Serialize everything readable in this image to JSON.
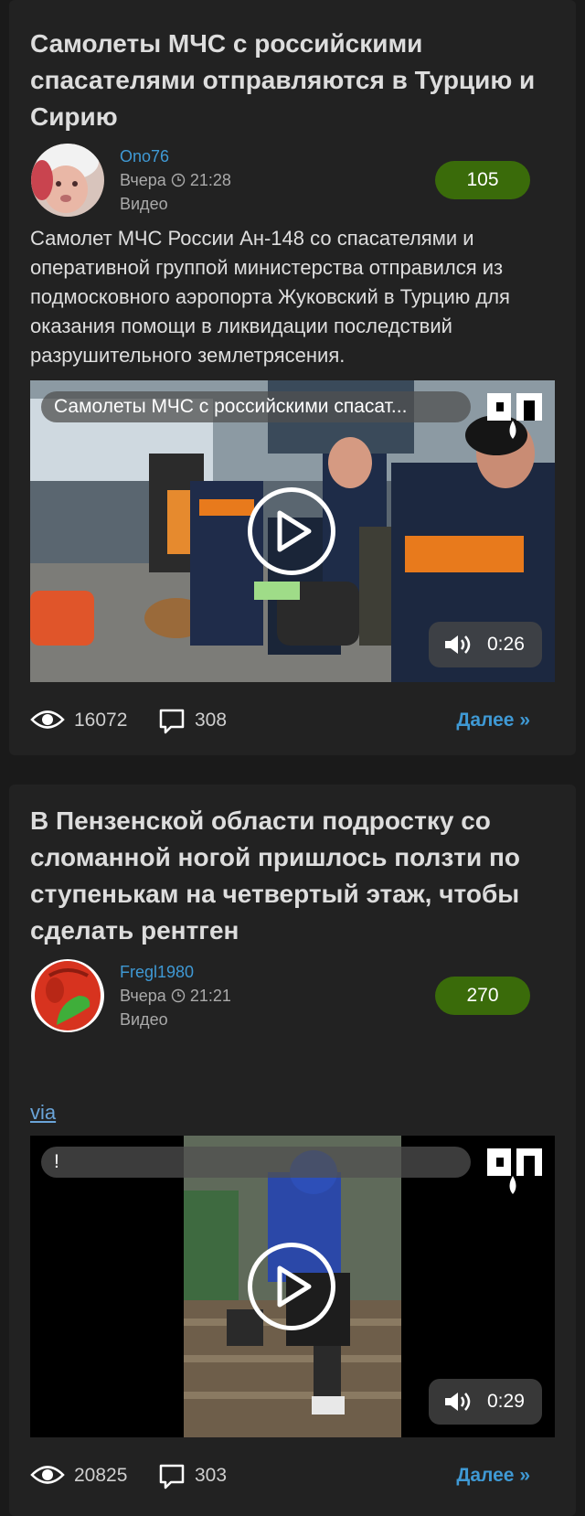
{
  "posts": [
    {
      "title": "Самолеты МЧС с российскими спасателями отправляются в Турцию и Сирию",
      "author": "Ono76",
      "time": "Вчера",
      "clock_time": "21:28",
      "kind": "Видео",
      "rating": "105",
      "description": "Самолет МЧС России Ан-148 со спасателями и оперативной группой министерства отправился из подмосковного аэропорта Жуковский в Турцию для оказания помощи в ликвидации последствий разрушительного землетрясения.",
      "video_title": "Самолеты МЧС с российскими спасат...",
      "video_logo": "ЯП",
      "duration": "0:26",
      "views": "16072",
      "comments": "308",
      "more_label": "Далее »"
    },
    {
      "title": "В Пензенской области подростку со сломанной ногой пришлось ползти по ступенькам на четвертый этаж, чтобы сделать рентген",
      "author": "Fregl1980",
      "time": "Вчера",
      "clock_time": "21:21",
      "kind": "Видео",
      "rating": "270",
      "via_label": "via",
      "video_title": "!",
      "video_logo": "ЯП",
      "duration": "0:29",
      "views": "20825",
      "comments": "303",
      "more_label": "Далее »"
    }
  ],
  "colors": {
    "background": "#1a1a1a",
    "card": "#222222",
    "link": "#3f99d4",
    "rating_bg": "#3a6b0a"
  },
  "icons": [
    "clock-icon",
    "play-icon",
    "volume-icon",
    "eye-icon",
    "comment-icon"
  ]
}
